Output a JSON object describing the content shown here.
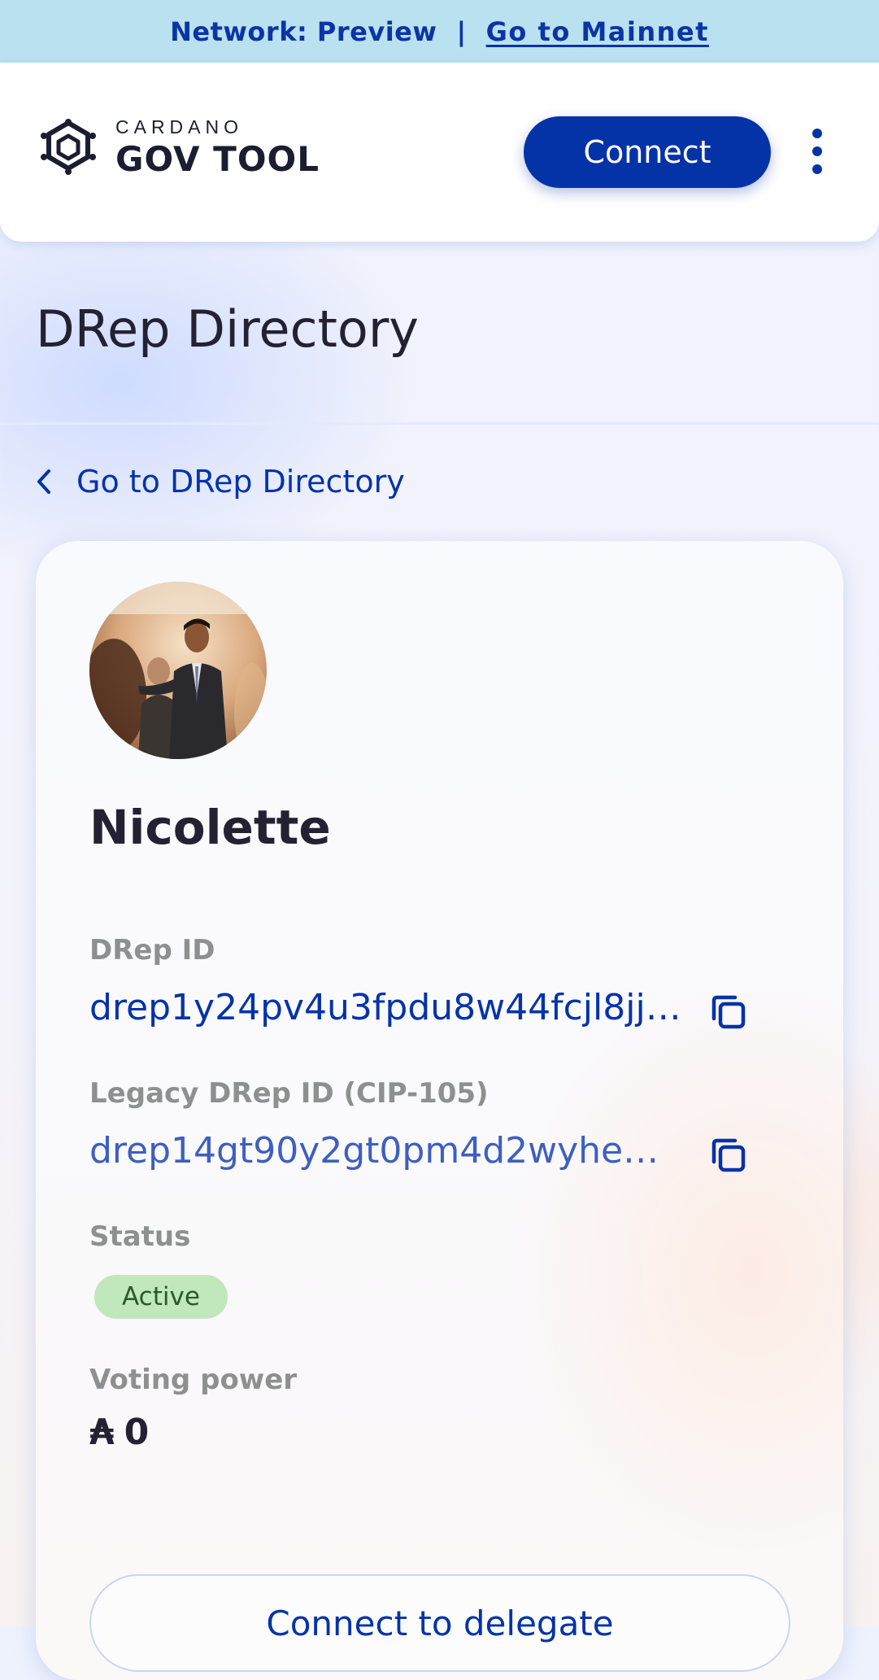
{
  "banner": {
    "network_text": "Network: Preview",
    "separator": "|",
    "mainnet_link": "Go to Mainnet"
  },
  "header": {
    "logo_small": "CARDANO",
    "logo_big": "GOV TOOL",
    "connect_label": "Connect"
  },
  "page": {
    "title": "DRep Directory",
    "back_link": "Go to DRep Directory"
  },
  "drep": {
    "name": "Nicolette",
    "id_label": "DRep ID",
    "id_value": "drep1y24pv4u3fpdu8w44fcjl8jje…",
    "legacy_id_label": "Legacy DRep ID (CIP-105)",
    "legacy_id_value": "drep14gt90y2gt0pm4d2wyheu…",
    "status_label": "Status",
    "status_value": "Active",
    "voting_power_label": "Voting power",
    "currency_symbol": "₳",
    "voting_power_value": "0",
    "delegate_button": "Connect to delegate"
  },
  "icons": {
    "logo": "cardano-hexagon-logo-icon",
    "menu": "kebab-menu-icon",
    "back": "chevron-left-icon",
    "copy": "copy-icon"
  },
  "colors": {
    "accent": "#0433a8",
    "banner_bg": "#b9e1f0",
    "status_active_bg": "#c1e7bd",
    "status_active_text": "#2b5a2a",
    "label_gray": "#8e908f"
  }
}
